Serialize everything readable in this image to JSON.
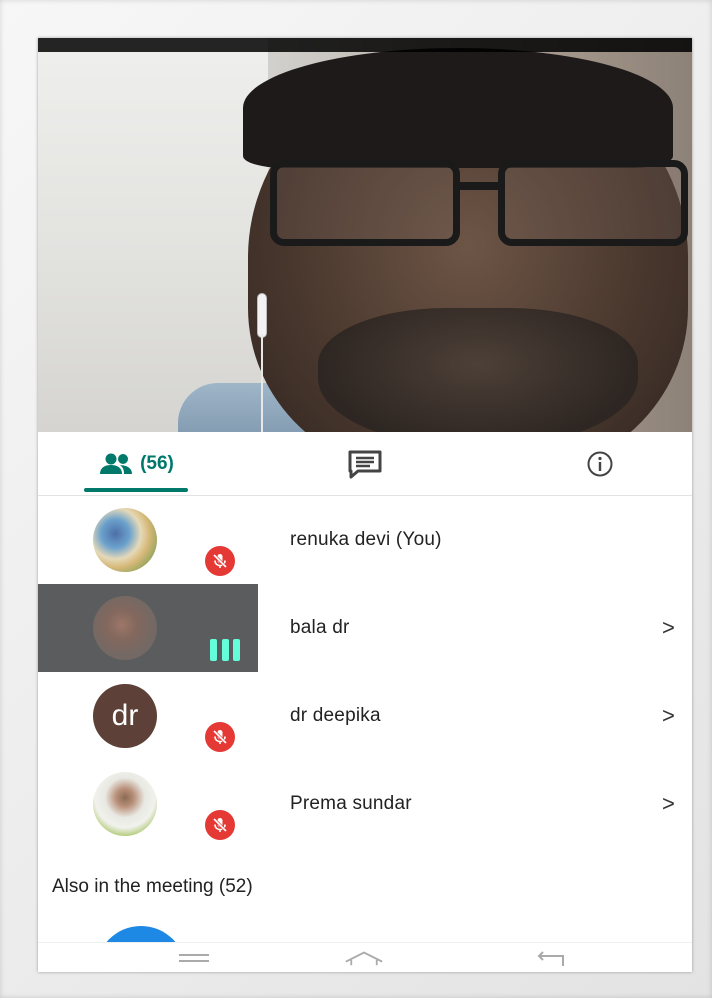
{
  "tabs": {
    "people_count": "(56)",
    "people_icon": "people-icon",
    "chat_icon": "chat-icon",
    "info_icon": "info-icon"
  },
  "participants": [
    {
      "name": "renuka devi (You)",
      "avatar": "photo",
      "status": "muted",
      "chevron": ""
    },
    {
      "name": "bala dr",
      "avatar": "photo",
      "status": "speaking",
      "chevron": ">"
    },
    {
      "name": "dr deepika",
      "avatar_initials": "dr",
      "status": "muted",
      "chevron": ">"
    },
    {
      "name": "Prema sundar",
      "avatar": "photo",
      "status": "muted",
      "chevron": ">"
    }
  ],
  "also_in_meeting": "Also in the meeting (52)",
  "colors": {
    "accent": "#00796b",
    "muted_badge": "#e53935",
    "speaking_indicator": "#64ffda",
    "highlight_row": "#5b5c5e",
    "initials_avatar": "#5d4037"
  }
}
